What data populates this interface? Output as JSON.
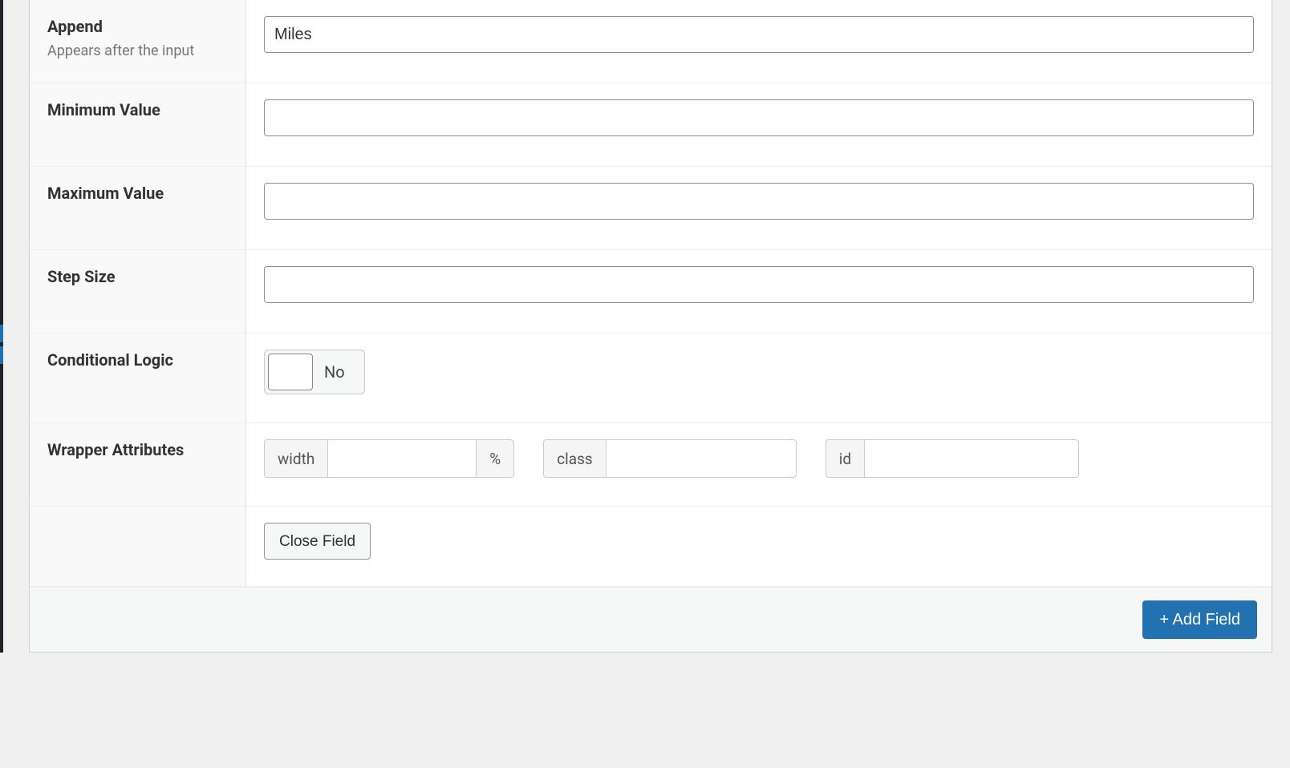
{
  "rows": {
    "append": {
      "title": "Append",
      "desc": "Appears after the input",
      "value": "Miles"
    },
    "min": {
      "title": "Minimum Value",
      "value": ""
    },
    "max": {
      "title": "Maximum Value",
      "value": ""
    },
    "step": {
      "title": "Step Size",
      "value": ""
    },
    "conditional": {
      "title": "Conditional Logic",
      "state_label": "No"
    },
    "wrapper": {
      "title": "Wrapper Attributes",
      "width_label": "width",
      "width_value": "",
      "width_unit": "%",
      "class_label": "class",
      "class_value": "",
      "id_label": "id",
      "id_value": ""
    }
  },
  "buttons": {
    "close_field": "Close Field",
    "add_field": "+ Add Field"
  }
}
